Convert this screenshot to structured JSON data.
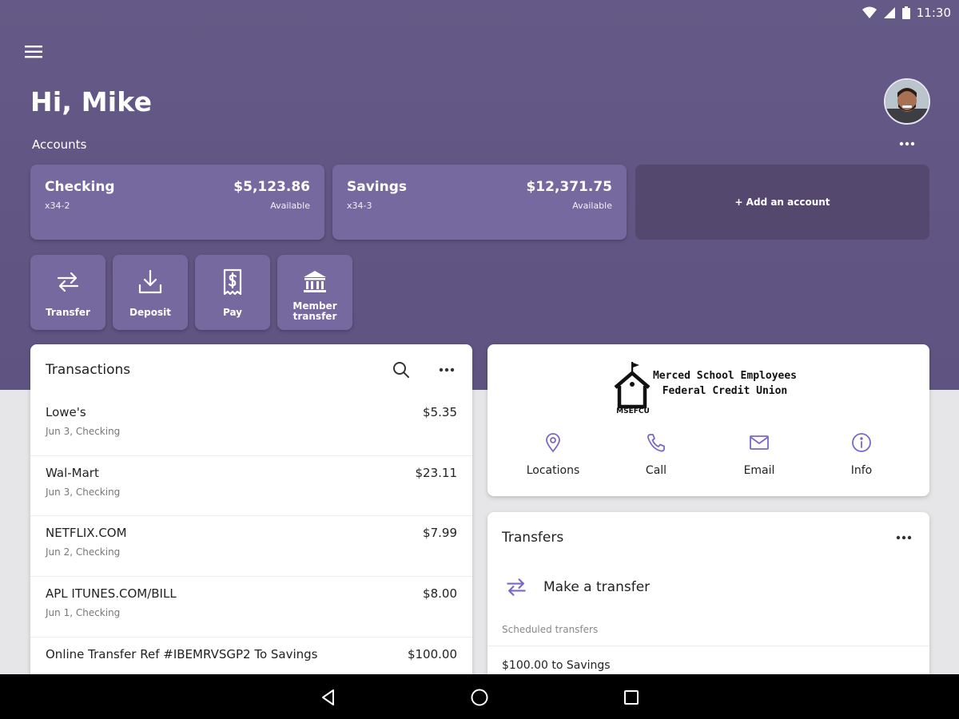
{
  "status_bar": {
    "time": "11:30"
  },
  "greeting": "Hi, Mike",
  "accounts_section": {
    "label": "Accounts"
  },
  "accounts": [
    {
      "name": "Checking",
      "number": "x34-2",
      "balance": "$5,123.86",
      "balance_label": "Available"
    },
    {
      "name": "Savings",
      "number": "x34-3",
      "balance": "$12,371.75",
      "balance_label": "Available"
    }
  ],
  "add_account": {
    "label": "+ Add an account"
  },
  "quick_actions": [
    {
      "label": "Transfer",
      "icon": "transfer-icon"
    },
    {
      "label": "Deposit",
      "icon": "deposit-icon"
    },
    {
      "label": "Pay",
      "icon": "pay-icon"
    },
    {
      "label": "Member\ntransfer",
      "icon": "bank-icon"
    }
  ],
  "transactions": {
    "title": "Transactions",
    "items": [
      {
        "merchant": "Lowe's",
        "detail": "Jun 3, Checking",
        "amount": "$5.35"
      },
      {
        "merchant": "Wal-Mart",
        "detail": "Jun 3, Checking",
        "amount": "$23.11"
      },
      {
        "merchant": "NETFLIX.COM",
        "detail": "Jun 2, Checking",
        "amount": "$7.99"
      },
      {
        "merchant": "APL ITUNES.COM/BILL",
        "detail": "Jun 1, Checking",
        "amount": "$8.00"
      },
      {
        "merchant": "Online Transfer Ref #IBEMRVSGP2 To Savings",
        "detail": "",
        "amount": "$100.00"
      }
    ]
  },
  "credit_union": {
    "name_line1": "Merced School Employees",
    "name_line2": "Federal Credit Union",
    "logo_text": "MSEFCU",
    "actions": [
      {
        "label": "Locations",
        "icon": "location-pin-icon"
      },
      {
        "label": "Call",
        "icon": "phone-icon"
      },
      {
        "label": "Email",
        "icon": "email-icon"
      },
      {
        "label": "Info",
        "icon": "info-icon"
      }
    ]
  },
  "transfers": {
    "title": "Transfers",
    "make_label": "Make a transfer",
    "scheduled_label": "Scheduled transfers",
    "scheduled_items": [
      "$100.00 to Savings"
    ]
  },
  "colors": {
    "brand_purple": "#655a87",
    "card_purple": "#76699f",
    "add_card_purple": "#54486f",
    "icon_accent": "#7b68c4"
  }
}
